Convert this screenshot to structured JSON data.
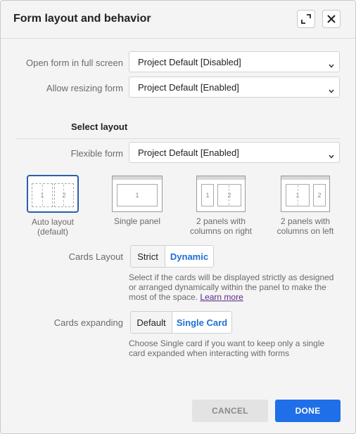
{
  "dialog": {
    "title": "Form layout and behavior",
    "expand_icon": "expand-icon",
    "close_icon": "close-icon"
  },
  "fields": {
    "full_screen": {
      "label": "Open form in full screen",
      "value": "Project Default [Disabled]"
    },
    "resizing": {
      "label": "Allow resizing form",
      "value": "Project Default [Enabled]"
    },
    "flexible": {
      "label": "Flexible form",
      "value": "Project Default [Enabled]"
    }
  },
  "layout": {
    "section_title": "Select layout",
    "options": [
      {
        "label_line1": "Auto layout",
        "label_line2": "(default)",
        "selected": true
      },
      {
        "label_line1": "Single panel",
        "label_line2": "",
        "selected": false
      },
      {
        "label_line1": "2 panels with",
        "label_line2": "columns on right",
        "selected": false
      },
      {
        "label_line1": "2 panels with",
        "label_line2": "columns on left",
        "selected": false
      }
    ],
    "panel_numbers": [
      "1",
      "2"
    ]
  },
  "cards_layout": {
    "label": "Cards Layout",
    "options": [
      "Strict",
      "Dynamic"
    ],
    "selected": "Dynamic",
    "help": "Select if the cards will be displayed strictly as designed or arranged dynamically within the panel to make the most of the space. ",
    "help_link": "Learn more"
  },
  "cards_expanding": {
    "label": "Cards expanding",
    "options": [
      "Default",
      "Single Card"
    ],
    "selected": "Single Card",
    "help": "Choose Single card if you want to keep only a single card expanded when interacting with forms"
  },
  "buttons": {
    "cancel": "CANCEL",
    "done": "DONE"
  },
  "colors": {
    "accent": "#1f6fe8",
    "selected_border": "#2a5fa8",
    "link": "#5a2a85"
  }
}
